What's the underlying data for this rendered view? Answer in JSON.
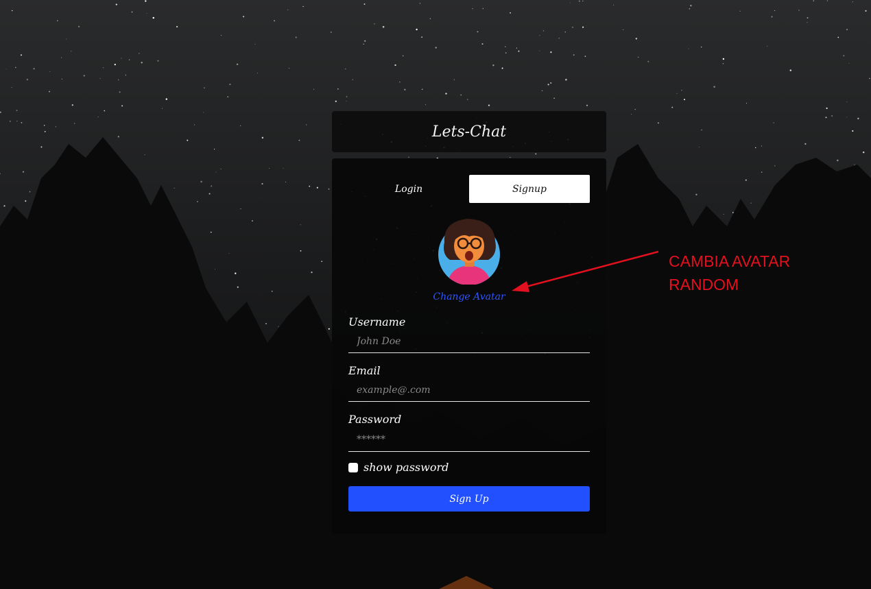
{
  "app": {
    "title": "Lets-Chat"
  },
  "tabs": [
    {
      "label": "Login",
      "active": false
    },
    {
      "label": "Signup",
      "active": true
    }
  ],
  "avatar": {
    "change_label": "Change Avatar"
  },
  "form": {
    "username": {
      "label": "Username",
      "placeholder": "John Doe"
    },
    "email": {
      "label": "Email",
      "placeholder": "example@.com"
    },
    "password": {
      "label": "Password",
      "placeholder": "******"
    },
    "show_password_label": "show password",
    "submit_label": "Sign Up"
  },
  "annotation": {
    "line1": "CAMBIA AVATAR",
    "line2": "RANDOM",
    "color": "#e3101f"
  },
  "colors": {
    "accent": "#2350ff",
    "link": "#2e55ff"
  }
}
